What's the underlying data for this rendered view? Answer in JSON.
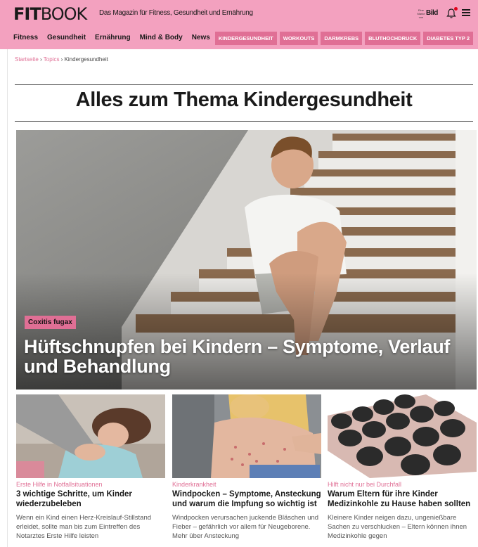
{
  "header": {
    "logo_bold": "FIT",
    "logo_light": "BOOK",
    "tagline": "Das Magazin für Fitness, Gesundheit und Ernährung",
    "bild_badge_small": "Eine Marke von",
    "bild_badge_big": "Bild",
    "nav_items": [
      "Fitness",
      "Gesundheit",
      "Ernährung",
      "Mind & Body",
      "News"
    ],
    "tag_items": [
      "KINDERGESUNDHEIT",
      "WORKOUTS",
      "DARMKREBS",
      "BLUTHOCHDRUCK",
      "DIABETES TYP 2"
    ]
  },
  "breadcrumb": {
    "home": "Startseite",
    "sep1": " › ",
    "topics": "Topics",
    "sep2": " › ",
    "current": "Kindergesundheit"
  },
  "page": {
    "title": "Alles zum Thema Kindergesundheit"
  },
  "hero": {
    "kicker": "Coxitis fugax",
    "title": "Hüftschnupfen bei Kindern – Symptome, Verlauf und Behandlung"
  },
  "cards": [
    {
      "kicker": "Erste Hilfe in Notfallsituationen",
      "title": "3 wichtige Schritte, um Kinder wiederzubeleben",
      "teaser": "Wenn ein Kind einen Herz-Kreislauf-Stillstand erleidet, sollte man bis zum Eintreffen des Notarztes Erste Hilfe leisten"
    },
    {
      "kicker": "Kinderkrankheit",
      "title": "Windpocken – Symptome, Ansteckung und warum die Impfung so wichtig ist",
      "teaser": "Windpocken verursachen juckende Bläschen und Fieber – gefährlich vor allem für Neugeborene. Mehr über Ansteckung"
    },
    {
      "kicker": "Hilft nicht nur bei Durchfall",
      "title": "Warum Eltern für ihre Kinder Medizinkohle zu Hause haben sollten",
      "teaser": "Kleinere Kinder neigen dazu, ungenießbare Sachen zu verschlucken – Eltern können ihnen Medizinkohle gegen"
    }
  ],
  "colors": {
    "brand_pink": "#f3a1bf",
    "accent_pink": "#e06f95",
    "notification_red": "#e2001a"
  },
  "icons": [
    "bell-icon",
    "menu-icon"
  ]
}
